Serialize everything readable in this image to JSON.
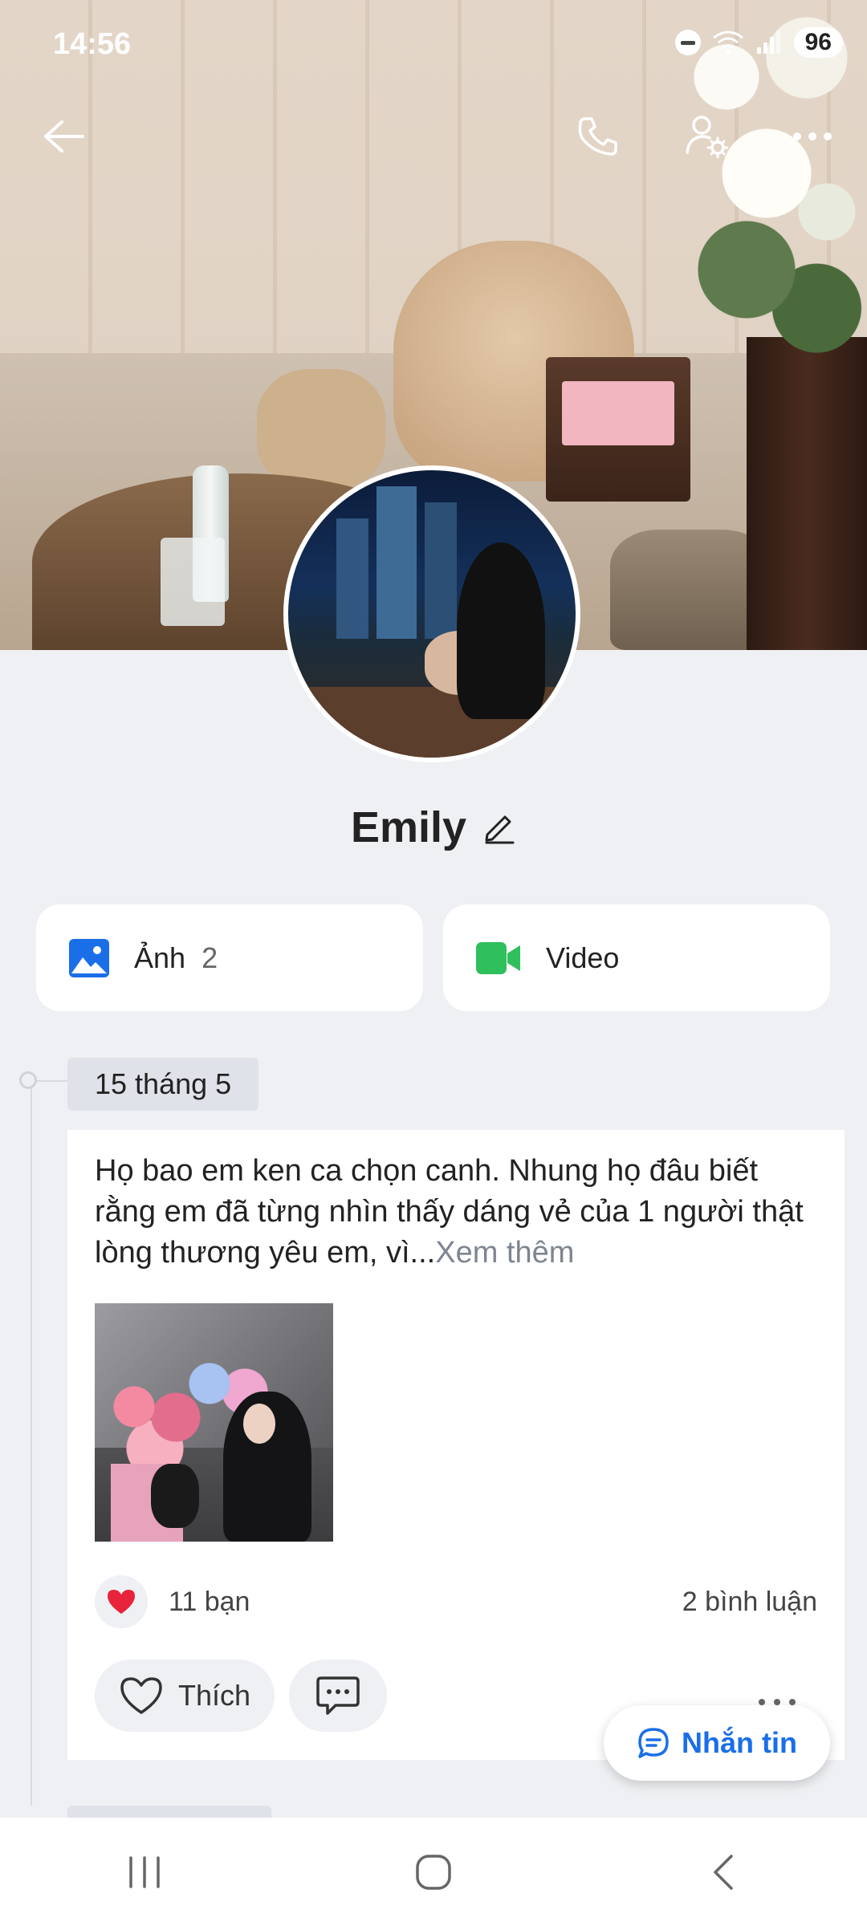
{
  "status_bar": {
    "time": "14:56",
    "battery": "96"
  },
  "profile": {
    "name": "Emily"
  },
  "media": {
    "photos_label": "Ảnh",
    "photos_count": "2",
    "video_label": "Video"
  },
  "timeline": {
    "date": "15 tháng 5"
  },
  "post": {
    "text": "Họ bao em ken ca chọn canh. Nhung họ đâu biết rằng em đã từng nhìn thấy dáng vẻ của 1 người thật lòng thương yêu em, vì...",
    "see_more": "Xem thêm",
    "reactions": "11 bạn",
    "comments": "2 bình luận",
    "like_label": "Thích"
  },
  "fab": {
    "label": "Nhắn tin"
  },
  "colors": {
    "accent": "#1a6fe8",
    "photo_icon": "#1a6fe8",
    "video_icon": "#2fbf5c",
    "heart": "#e8243c"
  }
}
